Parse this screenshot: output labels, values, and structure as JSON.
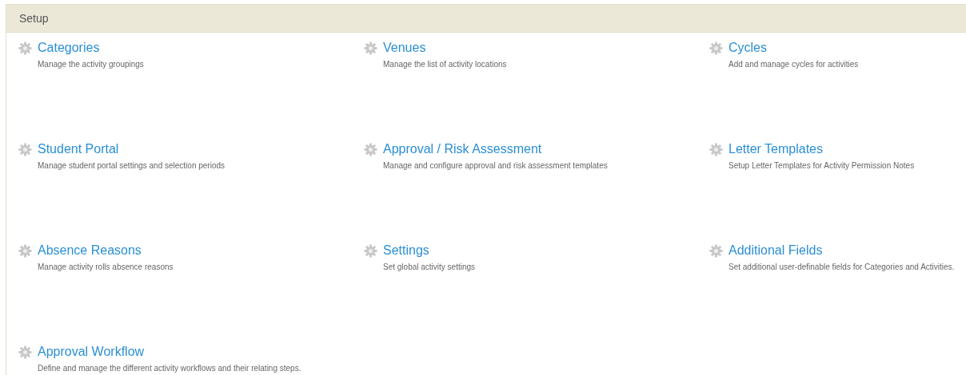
{
  "panel": {
    "title": "Setup"
  },
  "items": [
    {
      "title": "Categories",
      "description": "Manage the activity groupings"
    },
    {
      "title": "Venues",
      "description": "Manage the list of activity locations"
    },
    {
      "title": "Cycles",
      "description": "Add and manage cycles for activities"
    },
    {
      "title": "Student Portal",
      "description": "Manage student portal settings and selection periods"
    },
    {
      "title": "Approval / Risk Assessment",
      "description": "Manage and configure approval and risk assessment templates"
    },
    {
      "title": "Letter Templates",
      "description": "Setup Letter Templates for Activity Permission Notes"
    },
    {
      "title": "Absence Reasons",
      "description": "Manage activity rolls absence reasons"
    },
    {
      "title": "Settings",
      "description": "Set global activity settings"
    },
    {
      "title": "Additional Fields",
      "description": "Set additional user-definable fields for Categories and Activities."
    },
    {
      "title": "Approval Workflow",
      "description": "Define and manage the different activity workflows and their relating steps."
    }
  ]
}
